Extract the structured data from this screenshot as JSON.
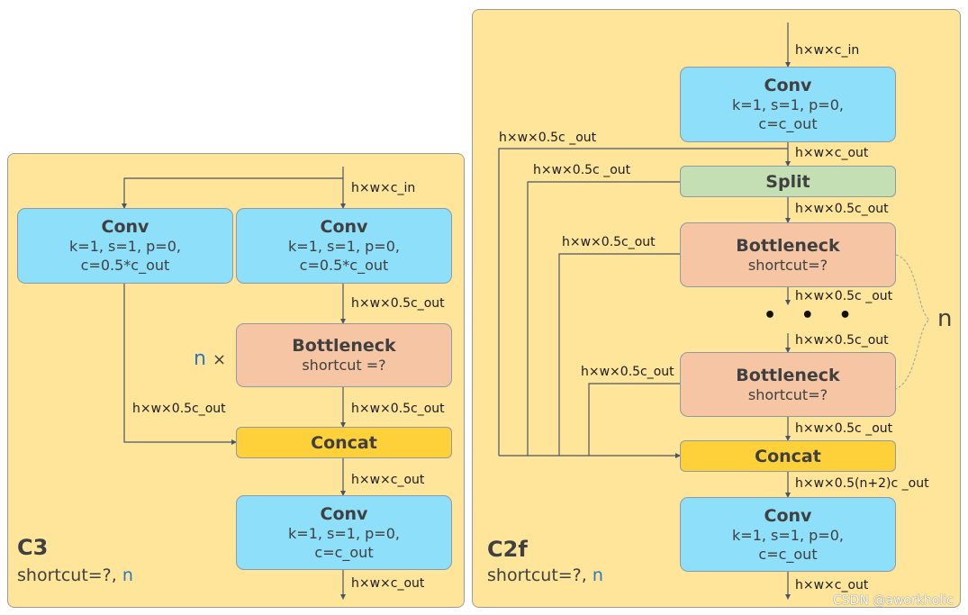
{
  "c3": {
    "name": "C3",
    "subtitle_prefix": "shortcut=?, ",
    "subtitle_n": "n",
    "input_label": "h×w×c_in",
    "conv_left": {
      "title": "Conv",
      "params": "k=1, s=1, p=0,\nc=0.5*c_out"
    },
    "conv_right": {
      "title": "Conv",
      "params": "k=1, s=1, p=0,\nc=0.5*c_out"
    },
    "after_conv_right_label": "h×w×0.5c_out",
    "repeat_n": "n",
    "repeat_times": "×",
    "bottleneck": {
      "title": "Bottleneck",
      "params": "shortcut =?"
    },
    "left_branch_label": "h×w×0.5c_out",
    "after_bottleneck_label": "h×w×0.5c_out",
    "concat": {
      "title": "Concat"
    },
    "after_concat_label": "h×w×c_out",
    "conv_out": {
      "title": "Conv",
      "params": "k=1, s=1, p=0,\nc=c_out"
    },
    "output_label": "h×w×c_out"
  },
  "c2f": {
    "name": "C2f",
    "subtitle_prefix": "shortcut=?, ",
    "subtitle_n": "n",
    "input_label": "h×w×c_in",
    "conv_in": {
      "title": "Conv",
      "params": "k=1, s=1, p=0,\nc=c_out"
    },
    "after_conv_label": "h×w×c_out",
    "skip1_label": "h×w×0.5c _out",
    "split": {
      "title": "Split"
    },
    "skip2_label": "h×w×0.5c _out",
    "after_split_label": "h×w×0.5c_out",
    "bottleneck1": {
      "title": "Bottleneck",
      "params": "shortcut=?"
    },
    "skip3_label": "h×w×0.5c_out",
    "after_b1_label": "h×w×0.5c _out",
    "ellipsis": "• • •",
    "before_bn_label": "h×w×0.5c_out",
    "repeat_n": "n",
    "bottleneck_n": {
      "title": "Bottleneck",
      "params": "shortcut=?"
    },
    "skip4_label": "h×w×0.5c_out",
    "after_bn_label": "h×w×0.5c _out",
    "concat": {
      "title": "Concat"
    },
    "after_concat_label": "h×w×0.5(n+2)c _out",
    "conv_out": {
      "title": "Conv",
      "params": "k=1, s=1, p=0,\nc=c_out"
    },
    "output_label": "h×w×c_out"
  },
  "watermark": "CSDN @aworkholic",
  "colors": {
    "panel": "#fee599",
    "conv": "#8ddffa",
    "bottleneck": "#f6c6a4",
    "concat": "#fed03a",
    "split": "#c4dfb3",
    "n_accent": "#2a78c0",
    "wire": "#4a5566"
  }
}
